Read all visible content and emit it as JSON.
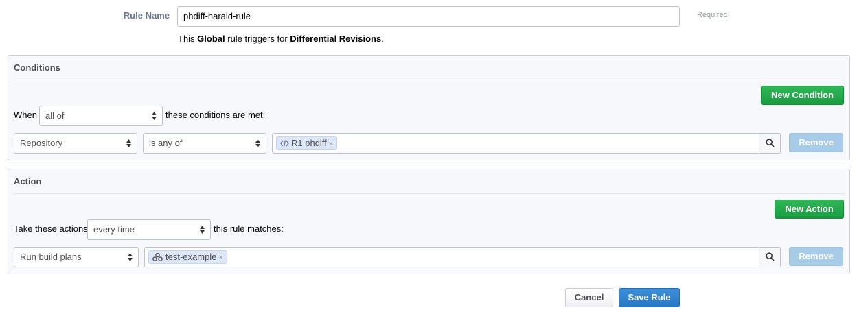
{
  "rule_name": {
    "label": "Rule Name",
    "value": "phdiff-harald-rule",
    "required_label": "Required"
  },
  "trigger": {
    "prefix": "This ",
    "scope": "Global",
    "middle": " rule triggers for ",
    "object": "Differential Revisions",
    "suffix": "."
  },
  "conditions": {
    "title": "Conditions",
    "new_button": "New Condition",
    "when_label": "When",
    "when_value": "all of",
    "when_suffix": "these conditions are met:",
    "rows": [
      {
        "field": "Repository",
        "operator": "is any of",
        "tokens": [
          {
            "label": "R1 phdiff",
            "icon": "code-icon"
          }
        ],
        "remove_label": "Remove"
      }
    ]
  },
  "action": {
    "title": "Action",
    "new_button": "New Action",
    "take_label": "Take these actions",
    "frequency_value": "every time",
    "take_suffix": "this rule matches:",
    "rows": [
      {
        "action": "Run build plans",
        "tokens": [
          {
            "label": "test-example",
            "icon": "build-plan-icon"
          }
        ],
        "remove_label": "Remove"
      }
    ]
  },
  "footer": {
    "cancel_label": "Cancel",
    "save_label": "Save Rule"
  },
  "colors": {
    "accent_green": "#1a9b41",
    "accent_blue": "#2779c6",
    "disabled_blue": "#a8cbe8",
    "token_bg": "#dee7f8"
  }
}
